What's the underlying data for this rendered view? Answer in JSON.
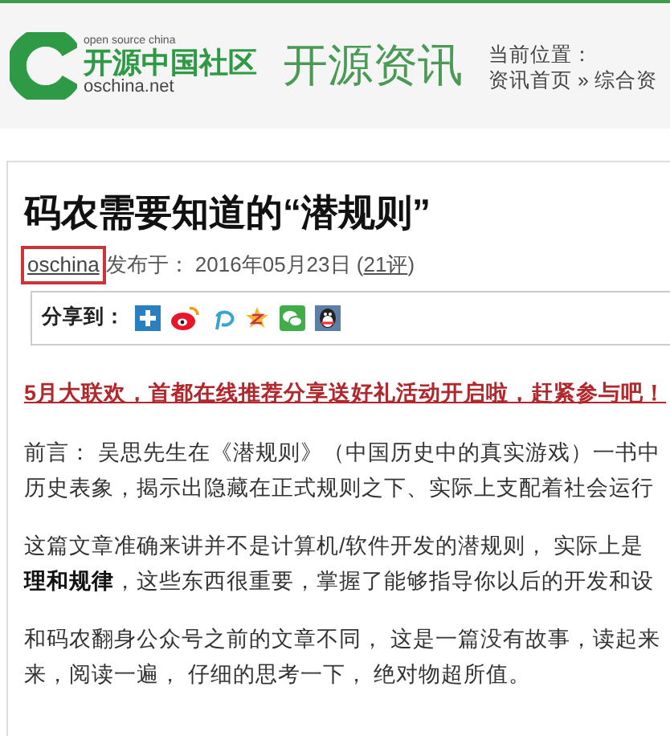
{
  "header": {
    "logo_tagline": "open source china",
    "logo_name": "开源中国社区",
    "logo_domain": "oschina.net",
    "section_title": "开源资讯",
    "breadcrumb_label": "当前位置：",
    "breadcrumb": "资讯首页 » 综合资"
  },
  "article": {
    "title": "码农需要知道的“潜规则”",
    "author": {
      "text": "oschina",
      "highlighted": true
    },
    "published": "发布于： 2016年05月23日 (",
    "comments": "21评",
    "comments_close": ")",
    "share": {
      "label": "分享到：",
      "icons": [
        {
          "kind": "plus"
        },
        {
          "kind": "weibo"
        },
        {
          "kind": "p"
        },
        {
          "kind": "star"
        },
        {
          "kind": "wechat"
        },
        {
          "kind": "qq"
        }
      ]
    },
    "promo": "5月大联欢，首都在线推荐分享送好礼活动开启啦，赶紧参与吧！",
    "paragraphs": [
      {
        "lines": [
          "前言： 吴思先生在《潜规则》（中国历史中的真实游戏）一书中",
          "历史表象，揭示出隐藏在正式规则之下、实际上支配着社会运行"
        ]
      },
      {
        "lines": [
          "这篇文章准确来讲并不是计算机/软件开发的潜规则， 实际上是",
          "**理和规律**，这些东西很重要，掌握了能够指导你以后的开发和设"
        ]
      },
      {
        "lines": [
          "和码农翻身公众号之前的文章不同， 这是一篇没有故事，读起来",
          "来，阅读一遍， 仔细的思考一下， 绝对物超所值。"
        ]
      }
    ]
  }
}
